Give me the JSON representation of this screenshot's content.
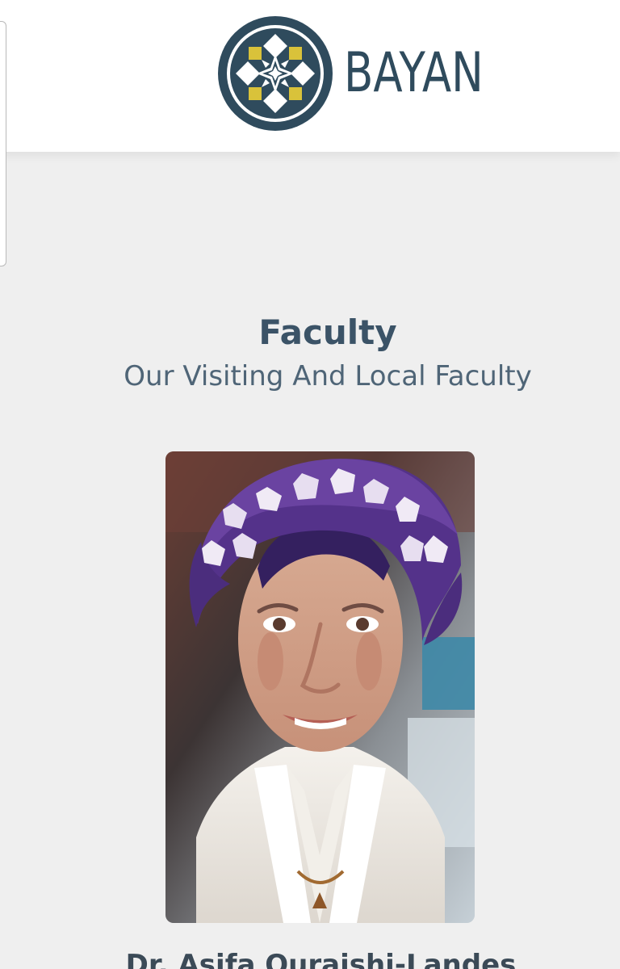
{
  "brand": {
    "name": "BAYAN",
    "colors": {
      "navy": "#2f4b5d",
      "gold": "#d9c23a",
      "white": "#ffffff"
    },
    "emblem_icon": "geometric-star-logo-icon"
  },
  "faculty_section": {
    "title": "Faculty",
    "subtitle": "Our Visiting And Local Faculty",
    "members": [
      {
        "name": "Dr. Asifa Quraishi-Landes",
        "photo_icon": "faculty-portrait-photo"
      }
    ]
  },
  "ui": {
    "background": "#efefef",
    "header_background": "#ffffff",
    "heading_color": "#3b5367",
    "subtitle_color": "#4f6577"
  }
}
